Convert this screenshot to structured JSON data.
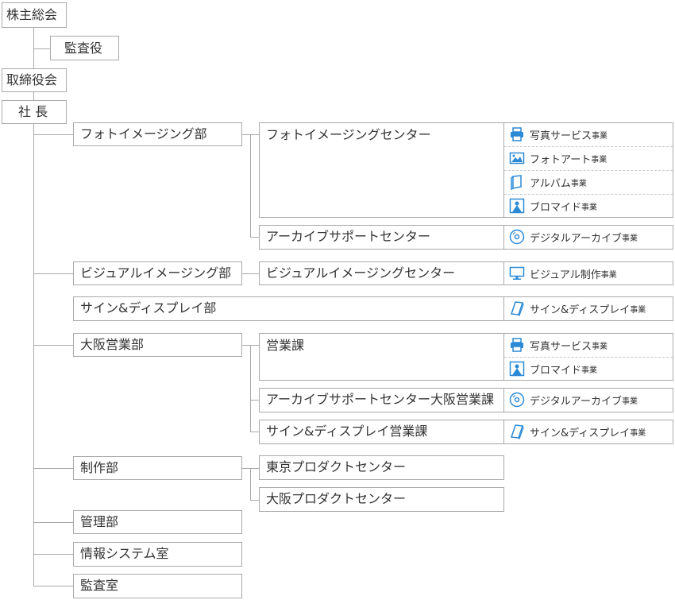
{
  "org": {
    "shareholders": "株主総会",
    "auditor": "監査役",
    "board": "取締役会",
    "president": "社 長",
    "photo_dept": "フォトイメージング部",
    "photo_center": "フォトイメージングセンター",
    "archive_center": "アーカイブサポートセンター",
    "visual_dept": "ビジュアルイメージング部",
    "visual_center": "ビジュアルイメージングセンター",
    "sign_dept": "サイン&ディスプレイ部",
    "osaka_sales_dept": "大阪営業部",
    "sales_section": "営業課",
    "archive_osaka": "アーカイブサポートセンター大阪営業課",
    "sign_sales": "サイン&ディスプレイ営業課",
    "production_dept": "制作部",
    "tokyo_product": "東京プロダクトセンター",
    "osaka_product": "大阪プロダクトセンター",
    "admin_dept": "管理部",
    "info_dept": "情報システム室",
    "audit_room": "監査室"
  },
  "business_suffix": "事業",
  "businesses": {
    "photo_service": {
      "label": "写真サービス",
      "icon": "printer-icon"
    },
    "photo_art": {
      "label": "フォトアート",
      "icon": "picture-icon"
    },
    "album": {
      "label": "アルバム",
      "icon": "book-icon"
    },
    "bromide": {
      "label": "ブロマイド",
      "icon": "portrait-icon"
    },
    "digital_archive": {
      "label": "デジタルアーカイブ",
      "icon": "disc-icon"
    },
    "visual_production": {
      "label": "ビジュアル制作",
      "icon": "monitor-icon"
    },
    "sign_display": {
      "label": "サイン&ディスプレイ",
      "icon": "panel-icon"
    }
  },
  "colors": {
    "line": "#a9a9a9",
    "icon": "#2b8ad6",
    "text": "#333333"
  }
}
